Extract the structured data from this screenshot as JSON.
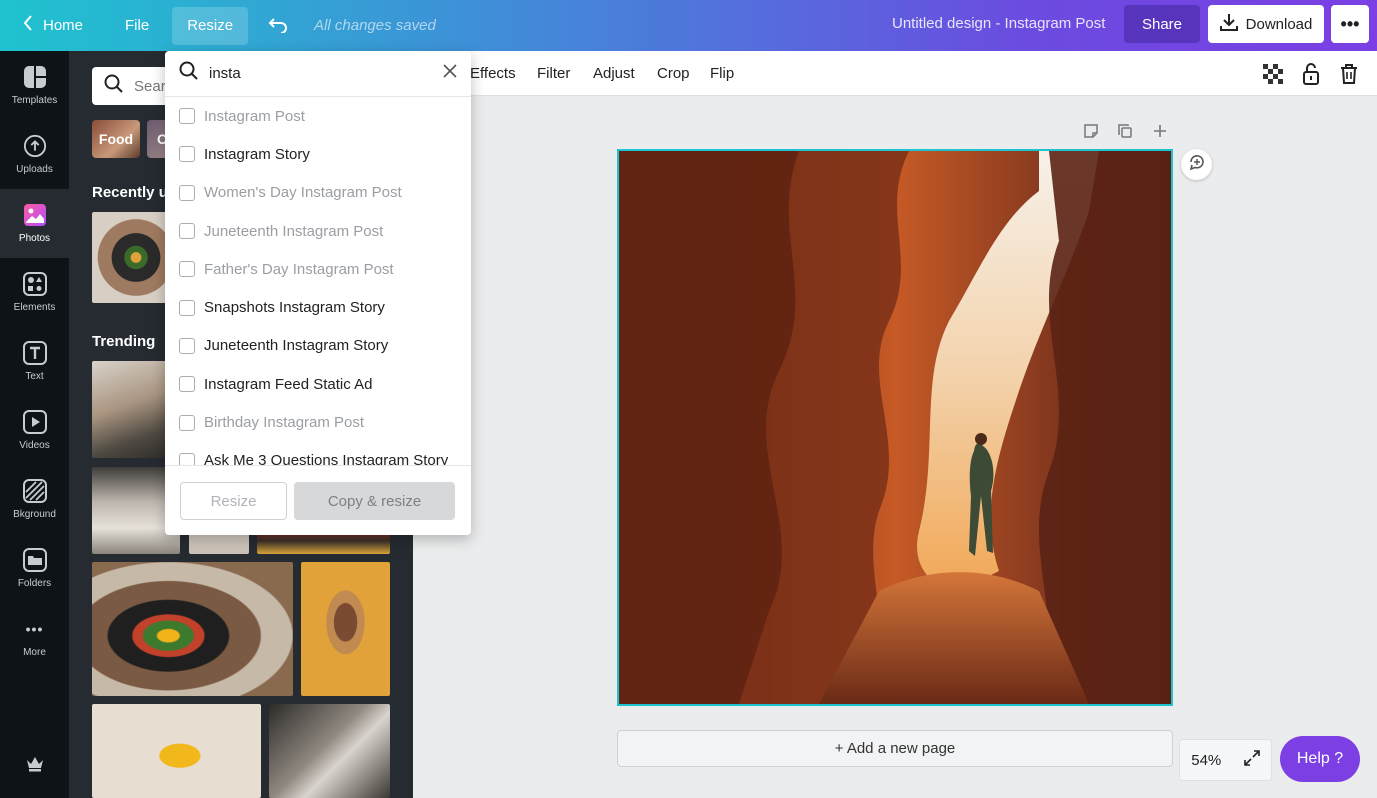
{
  "topbar": {
    "home": "Home",
    "file": "File",
    "resize": "Resize",
    "saved_status": "All changes saved",
    "design_title": "Untitled design - Instagram Post",
    "share": "Share",
    "download": "Download"
  },
  "rail": {
    "items": [
      {
        "label": "Templates",
        "icon": "templates-icon"
      },
      {
        "label": "Uploads",
        "icon": "upload-cloud-icon"
      },
      {
        "label": "Photos",
        "icon": "photo-icon"
      },
      {
        "label": "Elements",
        "icon": "shapes-icon"
      },
      {
        "label": "Text",
        "icon": "text-icon"
      },
      {
        "label": "Videos",
        "icon": "play-icon"
      },
      {
        "label": "Bkground",
        "icon": "hatch-icon"
      },
      {
        "label": "Folders",
        "icon": "folder-icon"
      },
      {
        "label": "More",
        "icon": "ellipsis-icon"
      }
    ]
  },
  "panel": {
    "search_placeholder": "Search",
    "chips": [
      "Food",
      "C"
    ],
    "recently_used": "Recently us",
    "trending": "Trending"
  },
  "toolbar": {
    "effects": "Effects",
    "filter": "Filter",
    "adjust": "Adjust",
    "crop": "Crop",
    "flip": "Flip"
  },
  "resize_dropdown": {
    "search_value": "insta",
    "items": [
      {
        "label": "Instagram Post",
        "muted": true
      },
      {
        "label": "Instagram Story",
        "muted": false
      },
      {
        "label": "Women's Day Instagram Post",
        "muted": true
      },
      {
        "label": "Juneteenth Instagram Post",
        "muted": true
      },
      {
        "label": "Father's Day Instagram Post",
        "muted": true
      },
      {
        "label": "Snapshots Instagram Story",
        "muted": false
      },
      {
        "label": "Juneteenth Instagram Story",
        "muted": false
      },
      {
        "label": "Instagram Feed Static Ad",
        "muted": false
      },
      {
        "label": "Birthday Instagram Post",
        "muted": true
      },
      {
        "label": "Ask Me 3 Questions Instagram Story",
        "muted": false
      }
    ],
    "resize_button": "Resize",
    "copy_resize_button": "Copy & resize"
  },
  "canvas": {
    "add_page": "+ Add a new page",
    "zoom": "54%"
  },
  "help": "Help ?",
  "colors": {
    "accent": "#1fc3cf",
    "brand_purple": "#7b3fe4",
    "rail_bg": "#0e1318",
    "panel_bg": "#252b31"
  }
}
